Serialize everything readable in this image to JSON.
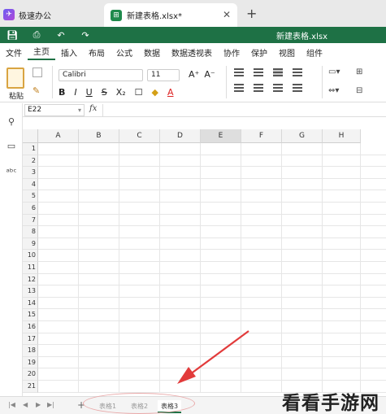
{
  "tabs": {
    "app_tab_label": "极速办公",
    "doc_tab_label": "新建表格.xlsx*",
    "close_glyph": "✕",
    "add_glyph": "+"
  },
  "titlebar": {
    "document_title": "新建表格.xlsx",
    "background_color": "#1e7145"
  },
  "menu": {
    "items": [
      "文件",
      "主页",
      "插入",
      "布局",
      "公式",
      "数据",
      "数据透视表",
      "协作",
      "保护",
      "视图",
      "组件"
    ],
    "active": "主页"
  },
  "ribbon": {
    "paste_label": "粘贴",
    "font_name": "Calibri",
    "font_size": "11",
    "format_buttons": [
      "B",
      "I",
      "U",
      "S",
      "X₂"
    ]
  },
  "formula_bar": {
    "cell_ref": "E22",
    "fx_label": "fx",
    "value": ""
  },
  "grid": {
    "columns": [
      "A",
      "B",
      "C",
      "D",
      "E",
      "F",
      "G",
      "H"
    ],
    "selected_column": "E",
    "rows": [
      "1",
      "2",
      "3",
      "4",
      "5",
      "6",
      "7",
      "8",
      "9",
      "10",
      "11",
      "12",
      "13",
      "14",
      "15",
      "16",
      "17",
      "18",
      "19",
      "20",
      "21"
    ]
  },
  "sheets": {
    "tabs": [
      "表格1",
      "表格2",
      "表格3"
    ],
    "active": "表格3",
    "add_glyph": "+"
  },
  "watermark": {
    "text": "看看手游网"
  }
}
